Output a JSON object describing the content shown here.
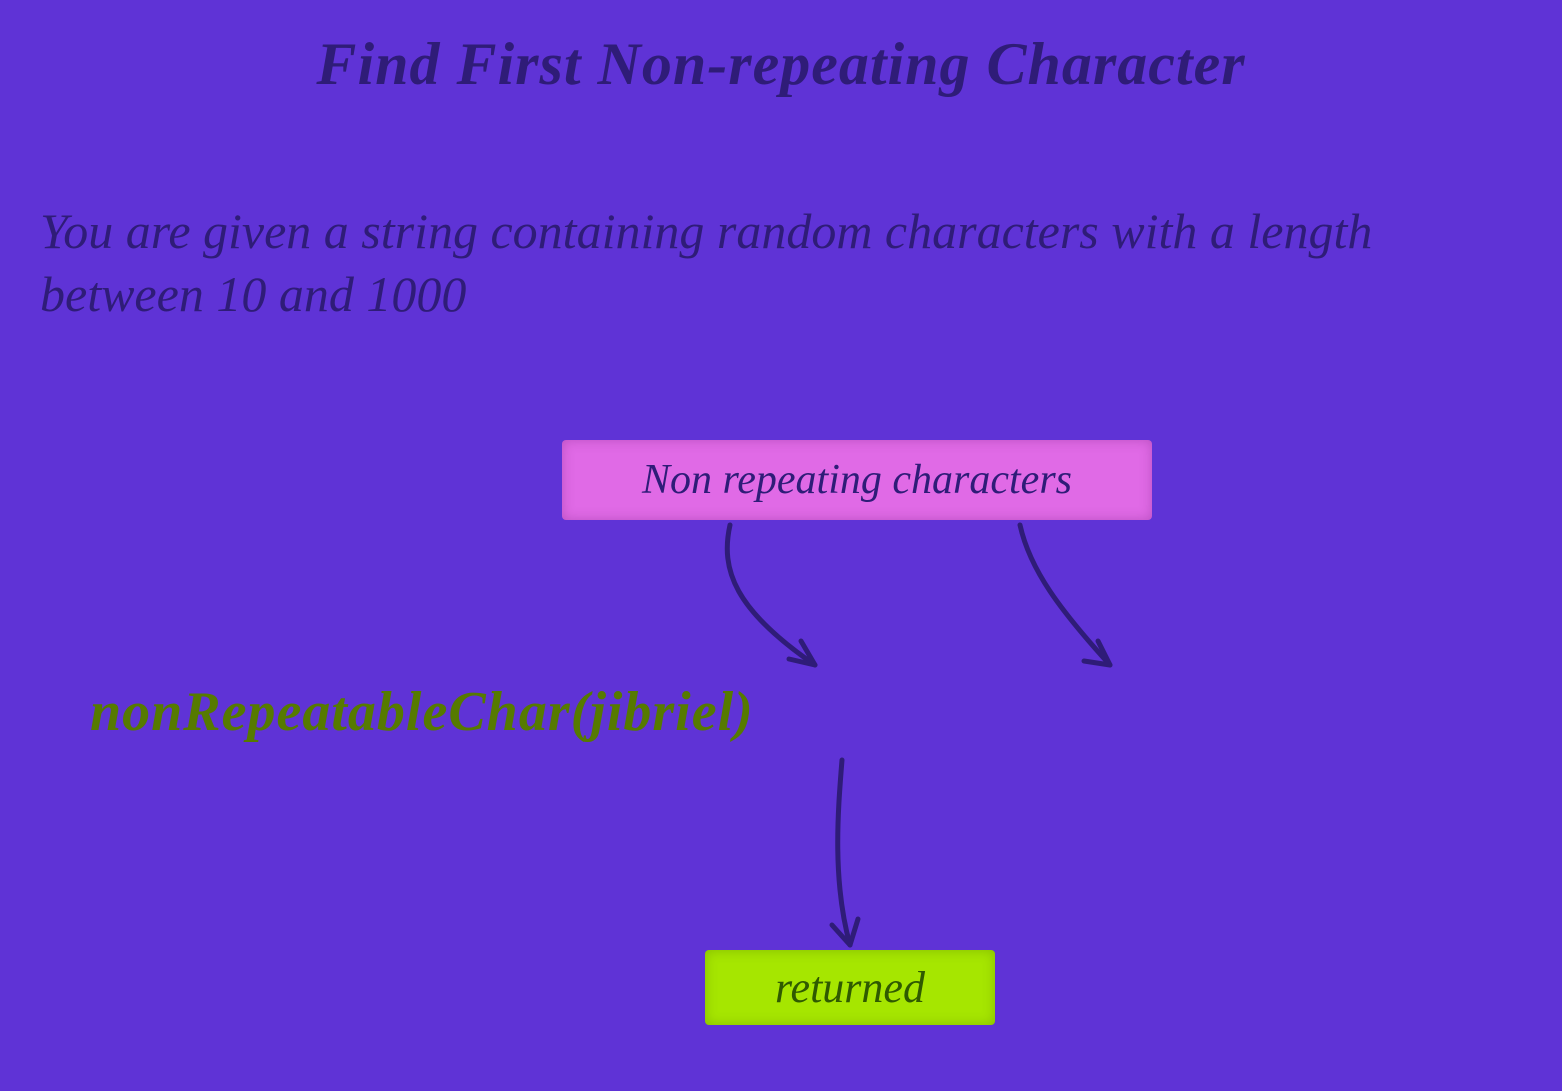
{
  "title": "Find First Non-repeating Character",
  "description": "You are given a string containing random characters with a length between 10 and 1000",
  "label_top": "Non repeating characters",
  "code_line": "nonRepeatableChar(jibriel)",
  "label_bottom": "returned",
  "colors": {
    "background": "#5f33d6",
    "text_dark": "#2f1c78",
    "code_green": "#567a00",
    "highlight_pink": "#e06ae6",
    "highlight_lime": "#a6e600"
  }
}
